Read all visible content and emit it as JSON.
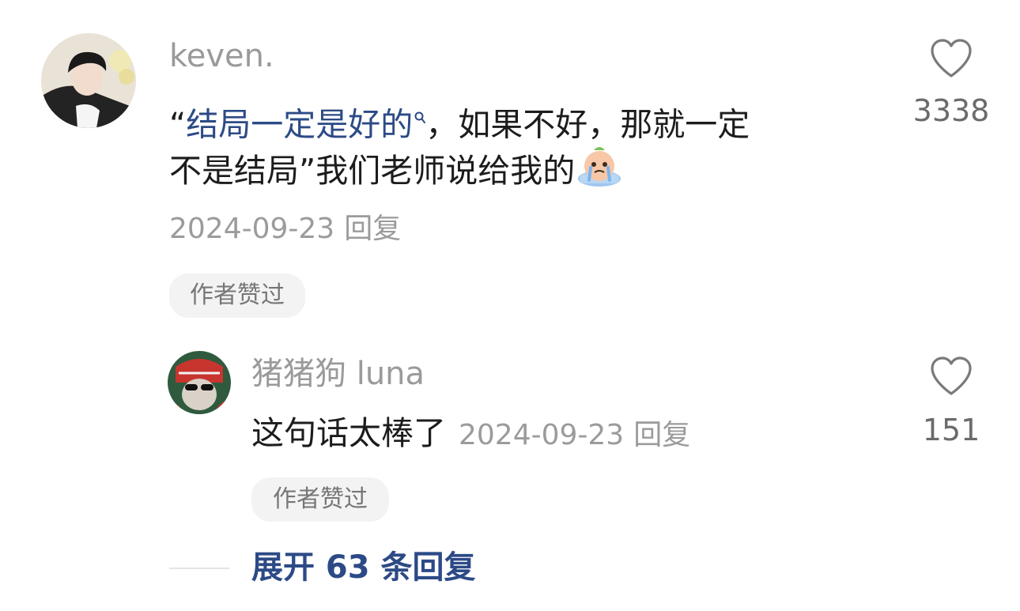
{
  "comment": {
    "username": "keven.",
    "text_quote_open": "“",
    "text_link": "结局一定是好的",
    "text_line1_rest": "，如果不好，那就一定",
    "text_line2": "不是结局”我们老师说给我的",
    "emoji_icon": "crying-bun-emoji",
    "date": "2024-09-23",
    "reply_label": "回复",
    "badge": "作者赞过",
    "like_count": "3338"
  },
  "reply": {
    "username": "猪猪狗 luna",
    "text": "这句话太棒了",
    "date": "2024-09-23",
    "reply_label": "回复",
    "badge": "作者赞过",
    "like_count": "151"
  },
  "expand": {
    "label": "展开 63 条回复"
  },
  "colors": {
    "link": "#2c4a86",
    "meta": "#9b9b9b",
    "chip_bg": "#f3f3f3"
  }
}
